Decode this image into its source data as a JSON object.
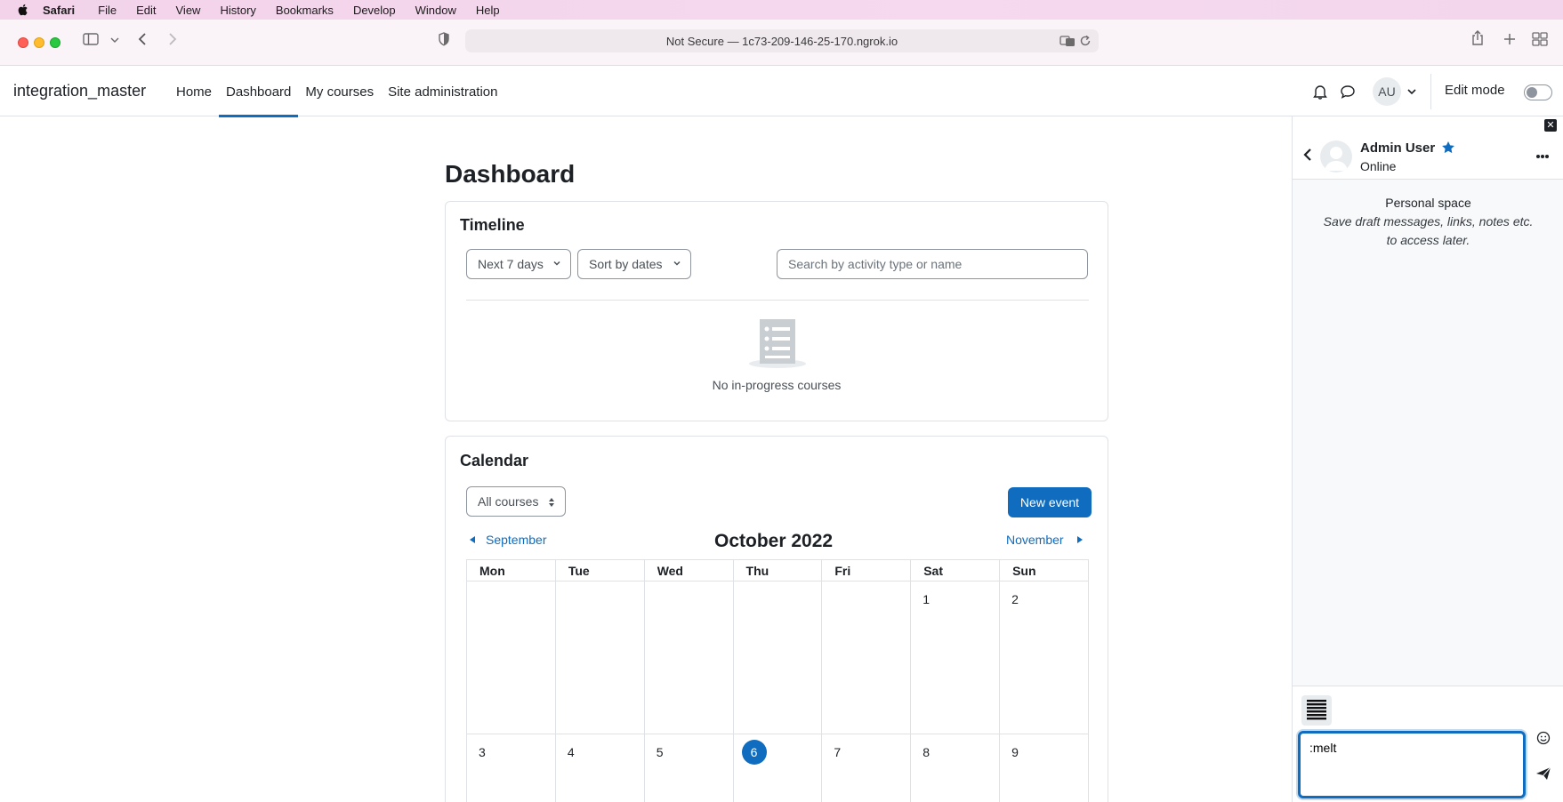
{
  "menubar": {
    "app_name": "Safari",
    "items": [
      "File",
      "Edit",
      "View",
      "History",
      "Bookmarks",
      "Develop",
      "Window",
      "Help"
    ]
  },
  "browser": {
    "url_text": "Not Secure — 1c73-209-146-25-170.ngrok.io"
  },
  "navbar": {
    "brand": "integration_master",
    "links": [
      {
        "label": "Home",
        "active": false
      },
      {
        "label": "Dashboard",
        "active": true
      },
      {
        "label": "My courses",
        "active": false
      },
      {
        "label": "Site administration",
        "active": false
      }
    ],
    "avatar_initials": "AU",
    "edit_mode_label": "Edit mode",
    "edit_mode_on": false
  },
  "page": {
    "title": "Dashboard"
  },
  "timeline": {
    "title": "Timeline",
    "range_select": "Next 7 days",
    "sort_select": "Sort by dates",
    "search_placeholder": "Search by activity type or name",
    "empty_text": "No in-progress courses"
  },
  "calendar": {
    "title": "Calendar",
    "course_select": "All courses",
    "new_event_label": "New event",
    "prev_month": "September",
    "next_month": "November",
    "month_title": "October 2022",
    "weekdays": [
      "Mon",
      "Tue",
      "Wed",
      "Thu",
      "Fri",
      "Sat",
      "Sun"
    ],
    "week1": [
      "",
      "",
      "",
      "",
      "",
      "1",
      "2"
    ],
    "week2": [
      "3",
      "4",
      "5",
      "6",
      "7",
      "8",
      "9"
    ],
    "today": "6"
  },
  "drawer": {
    "user_name": "Admin User",
    "status": "Online",
    "space_title": "Personal space",
    "space_desc_line1": "Save draft messages, links, notes etc.",
    "space_desc_line2": "to access later.",
    "message_value": ":melt",
    "accent": "#0f6cbf"
  }
}
